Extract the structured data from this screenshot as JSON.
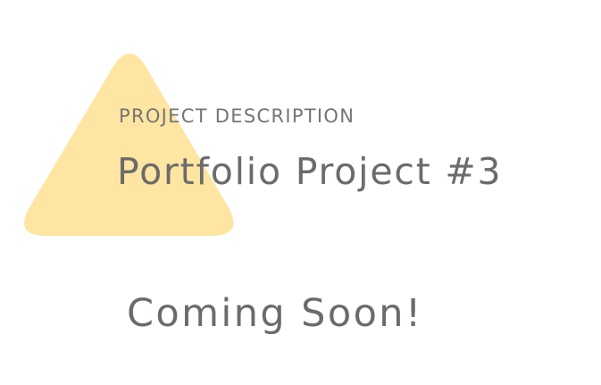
{
  "project": {
    "eyebrow": "PROJECT DESCRIPTION",
    "title": "Portfolio Project #3",
    "status": "Coming Soon!"
  },
  "colors": {
    "background": "#ffffff",
    "text": "#6b6b6b",
    "accent_shape": "#ffe49d"
  },
  "decoration": {
    "shape_name": "rounded-triangle"
  }
}
